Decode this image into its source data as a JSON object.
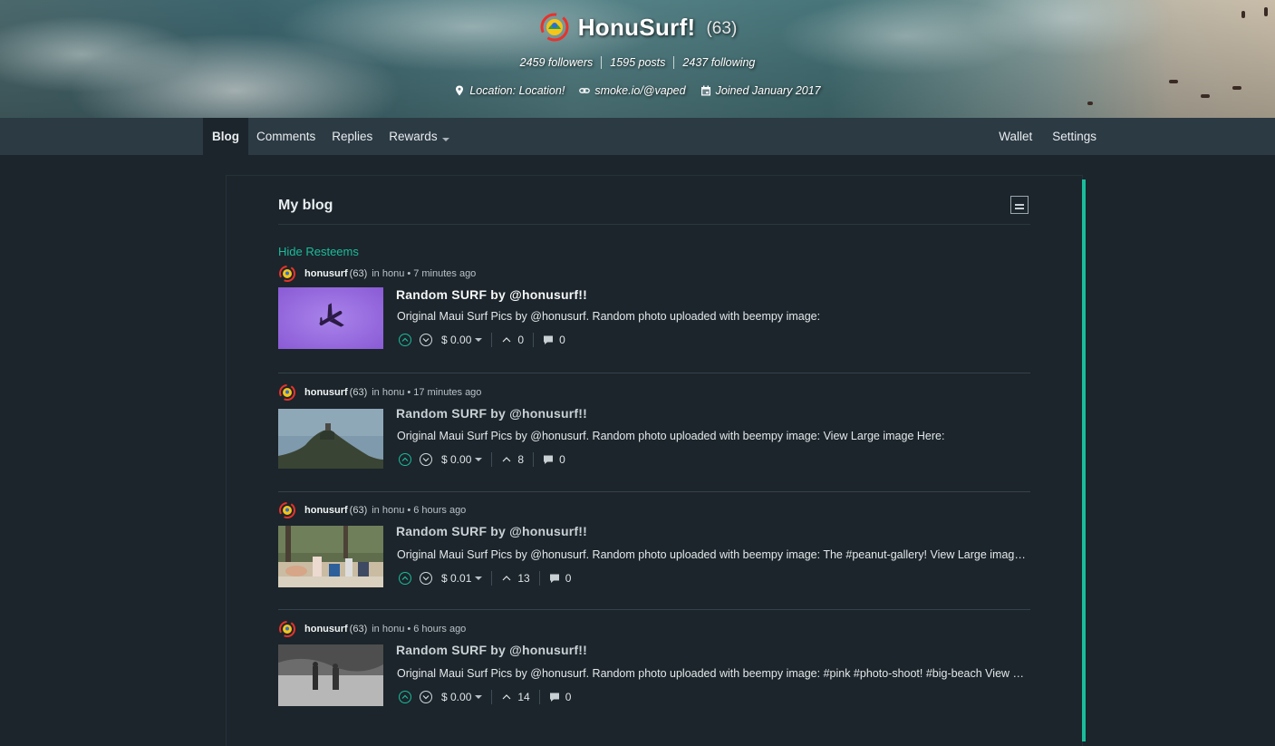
{
  "profile": {
    "name": "HonuSurf!",
    "reputation": "(63)",
    "followers": "2459 followers",
    "posts": "1595 posts",
    "following": "2437 following",
    "location": "Location: Location!",
    "website": "smoke.io/@vaped",
    "joined": "Joined January 2017"
  },
  "nav": {
    "tabs": [
      {
        "label": "Blog",
        "active": true
      },
      {
        "label": "Comments"
      },
      {
        "label": "Replies"
      },
      {
        "label": "Rewards",
        "dropdown": true
      }
    ],
    "right": [
      {
        "label": "Wallet"
      },
      {
        "label": "Settings"
      }
    ]
  },
  "blog": {
    "title": "My blog",
    "hide_resteems": "Hide Resteems"
  },
  "posts": [
    {
      "author": "honusurf",
      "rep": "(63)",
      "in": "in",
      "category": "honu",
      "bullet": "•",
      "time": "7 minutes ago",
      "title": "Random SURF by @honusurf!!",
      "body": "Original Maui Surf Pics by @honusurf. Random photo uploaded with beempy image:",
      "payout": "$ 0.00",
      "votes": "0",
      "comments": "0",
      "thumb": "airplane"
    },
    {
      "author": "honusurf",
      "rep": "(63)",
      "in": "in",
      "category": "honu",
      "bullet": "•",
      "time": "17 minutes ago",
      "title": "Random SURF by @honusurf!!",
      "body": "Original Maui Surf Pics by @honusurf. Random photo uploaded with beempy image: View Large image Here:",
      "payout": "$ 0.00",
      "votes": "8",
      "comments": "0",
      "thumb": "hill"
    },
    {
      "author": "honusurf",
      "rep": "(63)",
      "in": "in",
      "category": "honu",
      "bullet": "•",
      "time": "6 hours ago",
      "title": "Random SURF by @honusurf!!",
      "body": "Original Maui Surf Pics by @honusurf. Random photo uploaded with beempy image: The #peanut-gallery! View Large image Here:",
      "payout": "$ 0.01",
      "votes": "13",
      "comments": "0",
      "thumb": "beach"
    },
    {
      "author": "honusurf",
      "rep": "(63)",
      "in": "in",
      "category": "honu",
      "bullet": "•",
      "time": "6 hours ago",
      "title": "Random SURF by @honusurf!!",
      "body": "Original Maui Surf Pics by @honusurf. Random photo uploaded with beempy image: #pink #photo-shoot! #big-beach View Large image Here:",
      "payout": "$ 0.00",
      "votes": "14",
      "comments": "0",
      "thumb": "bw"
    }
  ],
  "colors": {
    "accent": "#1abc9c",
    "background": "#1c252b",
    "nav": "#2c3a44"
  },
  "icons": {
    "logo": "honu-logo-icon",
    "location": "map-pin-icon",
    "website": "link-icon",
    "joined": "calendar-icon",
    "layout": "layout-toggle-icon",
    "upvote": "chevron-up-circle-icon",
    "downvote": "chevron-down-circle-icon",
    "votes": "chevron-up-icon",
    "comments": "comment-bubble-icon"
  }
}
